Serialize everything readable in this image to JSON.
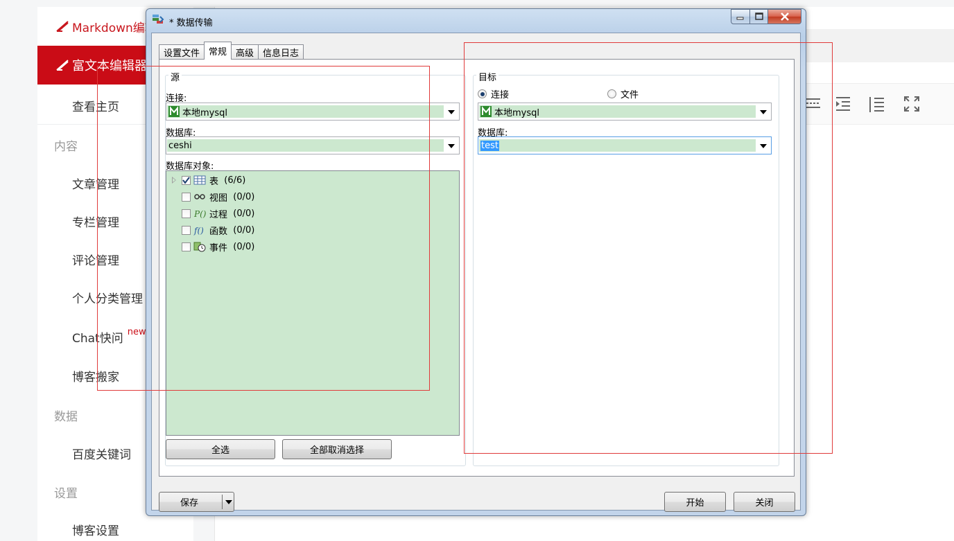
{
  "app": {
    "sidebar": {
      "brand_label": "Markdown编辑器",
      "active_label": "富文本编辑器",
      "home_label": "查看主页",
      "groups": {
        "content": "内容",
        "data": "数据",
        "settings": "设置"
      },
      "items": {
        "articles": "文章管理",
        "columns": "专栏管理",
        "comments": "评论管理",
        "categories": "个人分类管理",
        "chat": "Chat快问",
        "chat_badge": "new",
        "move": "博客搬家",
        "baidu": "百度关键词",
        "blog_settings": "博客设置"
      }
    }
  },
  "dialog": {
    "title": "* 数据传输",
    "tabs": [
      "设置文件",
      "常规",
      "高级",
      "信息日志"
    ],
    "active_tab": "常规",
    "source": {
      "group_label": "源",
      "connection_label": "连接:",
      "connection_value": "本地mysql",
      "database_label": "数据库:",
      "database_value": "ceshi",
      "objects_label": "数据库对象:",
      "objects": [
        {
          "label": "表",
          "count": "(6/6)"
        },
        {
          "label": "视图",
          "count": "(0/0)"
        },
        {
          "label": "过程",
          "count": "(0/0)"
        },
        {
          "label": "函数",
          "count": "(0/0)"
        },
        {
          "label": "事件",
          "count": "(0/0)"
        }
      ],
      "select_all": "全选",
      "deselect_all": "全部取消选择"
    },
    "target": {
      "group_label": "目标",
      "radio_connection": "连接",
      "radio_file": "文件",
      "connection_value": "本地mysql",
      "database_label": "数据库:",
      "database_value": "test"
    },
    "footer": {
      "save": "保存",
      "start": "开始",
      "close": "关闭"
    }
  },
  "colors": {
    "accent_red": "#ca0c16",
    "field_green": "#cce8cf",
    "selection_blue": "#3399ff"
  }
}
